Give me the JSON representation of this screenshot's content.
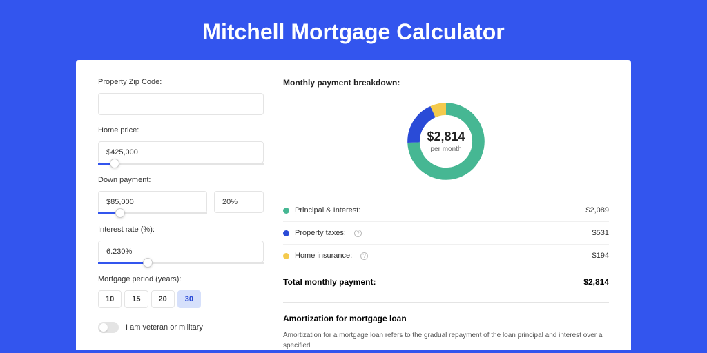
{
  "page_title": "Mitchell Mortgage Calculator",
  "form": {
    "zip_label": "Property Zip Code:",
    "zip_value": "",
    "price_label": "Home price:",
    "price_value": "$425,000",
    "price_slider_pct": 10,
    "down_label": "Down payment:",
    "down_value": "$85,000",
    "down_pct_value": "20%",
    "down_slider_pct": 20,
    "rate_label": "Interest rate (%):",
    "rate_value": "6.230%",
    "rate_slider_pct": 30,
    "term_label": "Mortgage period (years):",
    "terms": [
      "10",
      "15",
      "20",
      "30"
    ],
    "term_active": 3,
    "veteran_label": "I am veteran or military"
  },
  "breakdown": {
    "title": "Monthly payment breakdown:",
    "center_amount": "$2,814",
    "center_sub": "per month",
    "items": [
      {
        "label": "Principal & Interest:",
        "value": "$2,089",
        "color": "#46b793",
        "has_info": false
      },
      {
        "label": "Property taxes:",
        "value": "$531",
        "color": "#2a4bd7",
        "has_info": true
      },
      {
        "label": "Home insurance:",
        "value": "$194",
        "color": "#f4ca4d",
        "has_info": true
      }
    ],
    "total_label": "Total monthly payment:",
    "total_value": "$2,814"
  },
  "amortization": {
    "title": "Amortization for mortgage loan",
    "text": "Amortization for a mortgage loan refers to the gradual repayment of the loan principal and interest over a specified"
  },
  "chart_data": {
    "type": "pie",
    "title": "Monthly payment breakdown",
    "series": [
      {
        "name": "Principal & Interest",
        "value": 2089,
        "color": "#46b793"
      },
      {
        "name": "Property taxes",
        "value": 531,
        "color": "#2a4bd7"
      },
      {
        "name": "Home insurance",
        "value": 194,
        "color": "#f4ca4d"
      }
    ],
    "total": 2814,
    "center_label": "$2,814 per month"
  }
}
